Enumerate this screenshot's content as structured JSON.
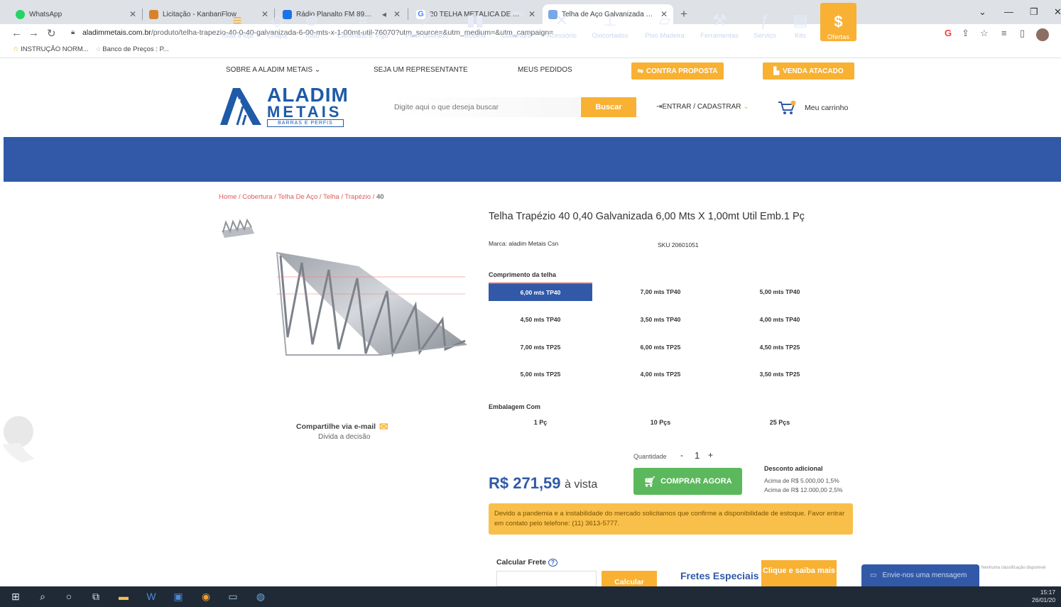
{
  "browser": {
    "tabs": [
      {
        "title": "WhatsApp",
        "color": "#25d366"
      },
      {
        "title": "Licitação - KanbanFlow",
        "color": "#d9822b"
      },
      {
        "title": "Rádio Planalto FM 89.3 - Pu",
        "color": "#1a73e8"
      },
      {
        "title": "20 TELHA METÁLICA DE ALUZIN",
        "color": "#4285f4"
      },
      {
        "title": "Telha de Aço Galvanizada Trapé",
        "color": "#7aa7e8"
      }
    ],
    "url_host": "aladimmetais.com.br",
    "url_path": "/produto/telha-trapezio-40-0-40-galvanizada-6-00-mts-x-1-00mt-util-76070?utm_source=&utm_medium=&utm_campaign=",
    "bookmarks": [
      "INSTRUÇÃO NORM...",
      "Banco de Preços : P..."
    ]
  },
  "site": {
    "top_links": [
      "SOBRE A ALADIM METAIS",
      "SEJA UM REPRESENTANTE",
      "MEUS PEDIDOS"
    ],
    "contra_proposta": "CONTRA PROPOSTA",
    "venda_atacado": "VENDA ATACADO",
    "logo_line1": "ALADIM",
    "logo_line2": "METAIS",
    "logo_tag": "BARRAS E PERFIS",
    "search_placeholder": "Digite aqui o que deseja buscar",
    "search_button": "Buscar",
    "login": "ENTRAR / CADASTRAR",
    "cart": "Meu carrinho"
  },
  "categories": [
    {
      "label": "Toda a loja",
      "icon": "≡"
    },
    {
      "label": "Chapa",
      "icon": "◇"
    },
    {
      "label": "Tubo",
      "icon": "⊚"
    },
    {
      "label": "Laminado e Viga",
      "icon": "⌗"
    },
    {
      "label": "Perfil Dobrado",
      "icon": "⟋"
    },
    {
      "label": "Bobina",
      "icon": "▮▮"
    },
    {
      "label": "Cobertura",
      "icon": "⌒"
    },
    {
      "label": "Acessório",
      "icon": "✕"
    },
    {
      "label": "Oxicortados",
      "icon": "⊥"
    },
    {
      "label": "Piso Madeira",
      "icon": "▱"
    },
    {
      "label": "Ferramentas",
      "icon": "⚒"
    },
    {
      "label": "Serviço",
      "icon": "ƒ"
    },
    {
      "label": "Kits",
      "icon": "▤"
    },
    {
      "label": "Ofertas",
      "icon": "$"
    }
  ],
  "breadcrumb": {
    "path": "Home / Cobertura / Telha De Aço / Telha / Trapézio / ",
    "current": "40"
  },
  "product": {
    "title": "Telha Trapézio 40 0,40 Galvanizada 6,00 Mts X 1,00mt Util Emb.1 Pç",
    "brand": "Marca:  aladim Metais Csn",
    "sku": "SKU 20601051",
    "length_label": "Comprimento da telha",
    "lengths": [
      "6,00 mts TP40",
      "7,00 mts TP40",
      "5,00 mts TP40",
      "4,50 mts TP40",
      "3,50 mts TP40",
      "4,00 mts TP40",
      "7,00 mts TP25",
      "6,00 mts TP25",
      "4,50 mts TP25",
      "5,00 mts TP25",
      "4,00 mts TP25",
      "3,50 mts TP25"
    ],
    "pack_label": "Embalagem Com",
    "packs": [
      "1 Pç",
      "10 Pçs",
      "25 Pçs"
    ],
    "qty_label": "Quantidade",
    "qty_minus": "-",
    "qty": "1",
    "qty_plus": "+",
    "price": "R$ 271,59",
    "price_suffix": "à vista",
    "buy": "COMPRAR AGORA",
    "discount_title": "Desconto adicional",
    "discounts": [
      "Acima de R$ 5.000,00   1,5%",
      "Acima de R$ 12.000,00   2,5%"
    ],
    "notice": "Devido a pandemia e a instabilidade do mercado solicitamos que confirme a disponibilidade de estoque. Favor entrar em contato pelo telefone: (11) 3613-5777.",
    "share": "Compartilhe via e-mail",
    "share_sub": "Divida a decisão"
  },
  "shipping": {
    "label": "Calcular Frete",
    "button": "Calcular",
    "special": "Fretes Especiais",
    "saiba": "Clique e saiba mais"
  },
  "chat": {
    "label": "Envie-nos uma mensagem",
    "note": "Nenhuma classificação disponível"
  },
  "taskbar": {
    "time": "15:17",
    "date": "26/01/20"
  },
  "colors": {
    "brand_blue": "#3159a8",
    "accent_orange": "#f8b133",
    "buy_green": "#5cb85c",
    "notice_yellow": "#f8c04a"
  }
}
